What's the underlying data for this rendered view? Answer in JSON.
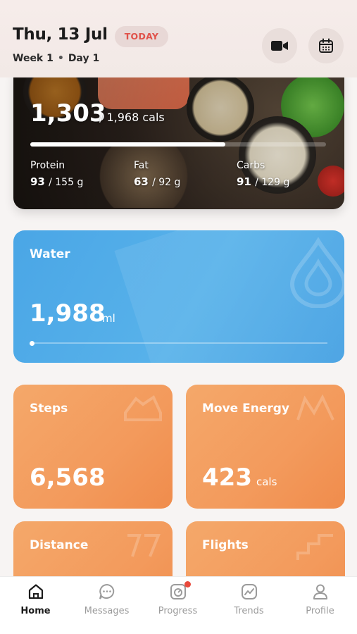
{
  "header": {
    "date": "Thu, 13 Jul",
    "today_badge": "TODAY",
    "week": "Week 1",
    "day": "Day 1",
    "video_icon": "video-camera-icon",
    "calendar_icon": "calendar-icon"
  },
  "calories": {
    "consumed": "1,303",
    "goal": "/ 1,968 cals",
    "progress": 0.66,
    "macros": [
      {
        "label": "Protein",
        "value": "93",
        "goal": "/ 155 g"
      },
      {
        "label": "Fat",
        "value": "63",
        "goal": "/ 92 g"
      },
      {
        "label": "Carbs",
        "value": "91",
        "goal": "/ 129 g"
      }
    ]
  },
  "water": {
    "title": "Water",
    "value": "1,988",
    "unit": "ml",
    "progress": 0.0
  },
  "cards": [
    {
      "title": "Steps",
      "value": "6,568",
      "unit": ""
    },
    {
      "title": "Move Energy",
      "value": "423",
      "unit": "cals"
    },
    {
      "title": "Distance",
      "value": "",
      "unit": ""
    },
    {
      "title": "Flights",
      "value": "",
      "unit": ""
    }
  ],
  "nav": [
    {
      "label": "Home",
      "icon": "home-icon",
      "active": true
    },
    {
      "label": "Messages",
      "icon": "message-bubble-icon",
      "active": false
    },
    {
      "label": "Progress",
      "icon": "progress-icon",
      "active": false
    },
    {
      "label": "Trends",
      "icon": "trends-icon",
      "active": false
    },
    {
      "label": "Profile",
      "icon": "profile-icon",
      "active": false
    }
  ],
  "colors": {
    "accent_red": "#e0524a",
    "water_blue": "#4aa6e6",
    "activity_orange": "#f39a5c"
  }
}
